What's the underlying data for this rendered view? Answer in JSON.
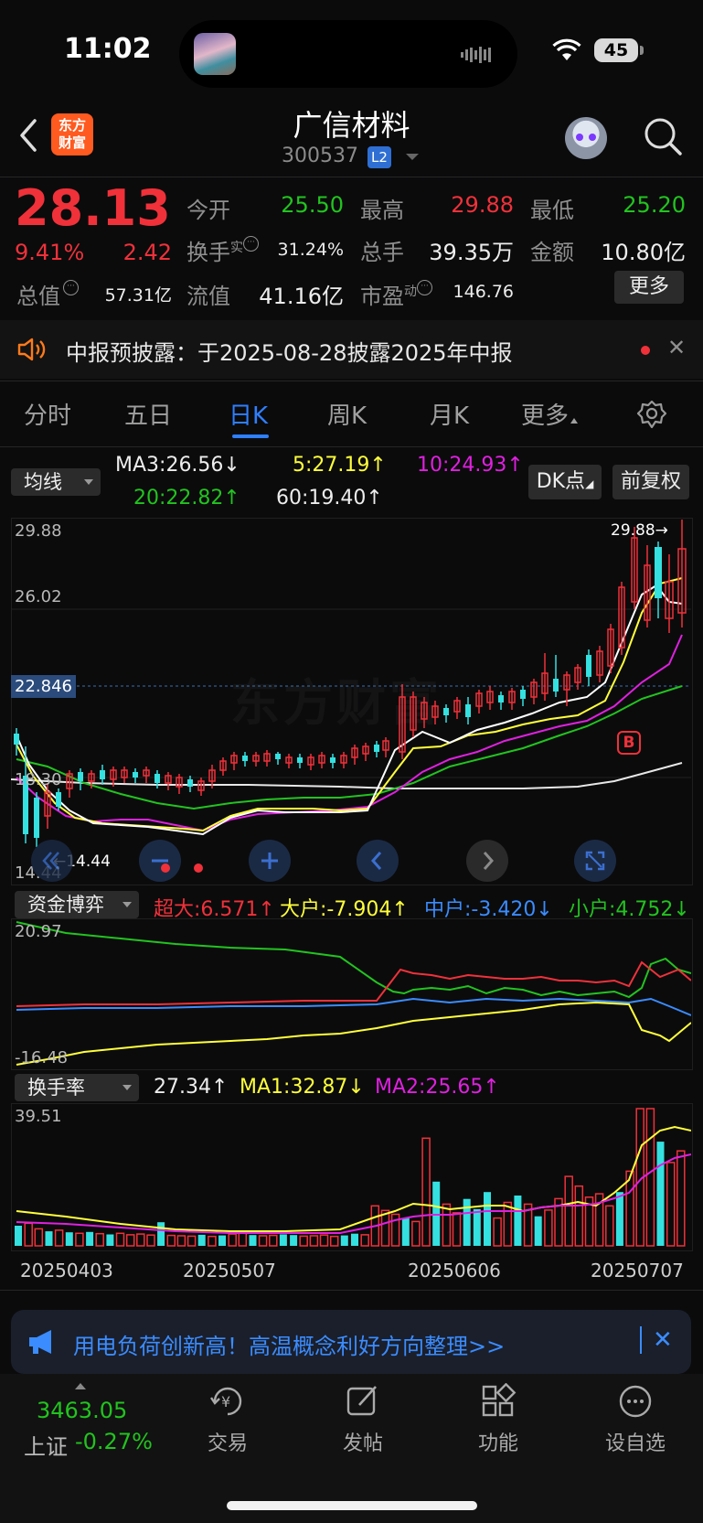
{
  "status": {
    "time": "11:02",
    "battery": "45"
  },
  "header": {
    "brand": "东方\n财富",
    "title": "广信材料",
    "code": "300537",
    "badge": "L2"
  },
  "quote": {
    "price": "28.13",
    "pct": "9.41%",
    "change": "2.42",
    "rows": [
      [
        {
          "label": "今开",
          "value": "25.50",
          "color": "green"
        },
        {
          "label": "最高",
          "value": "29.88",
          "color": "red"
        },
        {
          "label": "最低",
          "value": "25.20",
          "color": "green"
        }
      ],
      [
        {
          "label": "换手",
          "sup": "实",
          "value": "31.24%",
          "color": "white"
        },
        {
          "label": "总手",
          "value": "39.35万",
          "color": "white"
        },
        {
          "label": "金额",
          "value": "10.80亿",
          "color": "white"
        }
      ],
      [
        {
          "label": "总值",
          "value": "57.31亿",
          "color": "white"
        },
        {
          "label": "流值",
          "value": "41.16亿",
          "color": "white"
        },
        {
          "label": "市盈",
          "sup": "动",
          "value": "146.76",
          "color": "white"
        }
      ]
    ],
    "more_label": "更多"
  },
  "notice": {
    "text": "中报预披露：于2025-08-28披露2025年中报"
  },
  "tabs": [
    {
      "label": "分时"
    },
    {
      "label": "五日"
    },
    {
      "label": "日K",
      "active": true
    },
    {
      "label": "周K"
    },
    {
      "label": "月K"
    },
    {
      "label": "更多"
    }
  ],
  "ma_panel": {
    "select": "均线",
    "ma3": "MA3:26.56↓",
    "ma5": "5:27.19↑",
    "ma10": "10:24.93↑",
    "ma20": "20:22.82↑",
    "ma60": "60:19.40↑",
    "dk_label": "DK点",
    "adj_label": "前复权"
  },
  "price_chart": {
    "y_top": "29.88",
    "y_mid": "26.02",
    "y_cur": "22.846",
    "y_mid2": "18.30",
    "y_bot": "14.44",
    "high_mark": "29.88→",
    "low_mark": "←14.44",
    "buy_mark": "B",
    "watermark": "东方财富"
  },
  "fund_panel": {
    "select": "资金博弈",
    "super": "超大:6.571↑",
    "big": "大户:-7.904↑",
    "mid": "中户:-3.420↓",
    "small": "小户:4.752↓",
    "y_top": "20.97",
    "y_bot": "-16.48"
  },
  "turnover_panel": {
    "select": "换手率",
    "value": "27.34↑",
    "ma1": "MA1:32.87↓",
    "ma2": "MA2:25.65↑",
    "y_top": "39.51"
  },
  "dates": [
    "20250403",
    "20250507",
    "20250606",
    "20250707"
  ],
  "banner": {
    "text": "用电负荷创新高！高温概念利好方向整理>>"
  },
  "bottom_nav": {
    "index_value": "3463.05",
    "index_name": "上证",
    "index_pct": "-0.27%",
    "items": [
      {
        "label": "交易"
      },
      {
        "label": "发帖"
      },
      {
        "label": "功能"
      },
      {
        "label": "设自选"
      }
    ]
  },
  "colors": {
    "up": "#f0313a",
    "down": "#22c31f",
    "accent": "#2f7fff",
    "ma5": "#ffff3a",
    "ma10": "#e020e0",
    "ma60": "#ffffff",
    "bar_down": "#34e0e0"
  },
  "chart_data": {
    "type": "candlestick",
    "turnover_bars": [
      {
        "v": 5.8,
        "c": "d"
      },
      {
        "v": 6.5,
        "c": "u"
      },
      {
        "v": 4.9,
        "c": "u"
      },
      {
        "v": 4.2,
        "c": "d"
      },
      {
        "v": 4.5,
        "c": "u"
      },
      {
        "v": 3.9,
        "c": "d"
      },
      {
        "v": 3.6,
        "c": "u"
      },
      {
        "v": 4.0,
        "c": "d"
      },
      {
        "v": 3.5,
        "c": "u"
      },
      {
        "v": 3.3,
        "c": "d"
      },
      {
        "v": 3.6,
        "c": "u"
      },
      {
        "v": 3.2,
        "c": "u"
      },
      {
        "v": 3.4,
        "c": "u"
      },
      {
        "v": 3.1,
        "c": "u"
      },
      {
        "v": 6.8,
        "c": "d"
      },
      {
        "v": 3.0,
        "c": "u"
      },
      {
        "v": 2.9,
        "c": "u"
      },
      {
        "v": 2.8,
        "c": "u"
      },
      {
        "v": 3.2,
        "c": "d"
      },
      {
        "v": 2.7,
        "c": "u"
      },
      {
        "v": 3.0,
        "c": "d"
      },
      {
        "v": 3.4,
        "c": "u"
      },
      {
        "v": 4.2,
        "c": "u"
      },
      {
        "v": 3.1,
        "c": "d"
      },
      {
        "v": 2.9,
        "c": "u"
      },
      {
        "v": 3.0,
        "c": "u"
      },
      {
        "v": 3.3,
        "c": "d"
      },
      {
        "v": 3.1,
        "c": "d"
      },
      {
        "v": 2.8,
        "c": "u"
      },
      {
        "v": 2.9,
        "c": "u"
      },
      {
        "v": 3.1,
        "c": "u"
      },
      {
        "v": 2.7,
        "c": "u"
      },
      {
        "v": 3.0,
        "c": "d"
      },
      {
        "v": 3.5,
        "c": "d"
      },
      {
        "v": 3.2,
        "c": "u"
      },
      {
        "v": 11.5,
        "c": "u"
      },
      {
        "v": 10.2,
        "c": "u"
      },
      {
        "v": 9.1,
        "c": "u"
      },
      {
        "v": 8.0,
        "c": "d"
      },
      {
        "v": 7.0,
        "c": "u"
      },
      {
        "v": 31.0,
        "c": "u"
      },
      {
        "v": 18.5,
        "c": "d"
      },
      {
        "v": 12.0,
        "c": "u"
      },
      {
        "v": 9.5,
        "c": "u"
      },
      {
        "v": 13.5,
        "c": "d"
      },
      {
        "v": 10.6,
        "c": "d"
      },
      {
        "v": 15.5,
        "c": "d"
      },
      {
        "v": 8.0,
        "c": "u"
      },
      {
        "v": 12.5,
        "c": "u"
      },
      {
        "v": 14.5,
        "c": "d"
      },
      {
        "v": 12.0,
        "c": "u"
      },
      {
        "v": 8.5,
        "c": "d"
      },
      {
        "v": 10.3,
        "c": "u"
      },
      {
        "v": 13.6,
        "c": "u"
      },
      {
        "v": 20.0,
        "c": "u"
      },
      {
        "v": 17.2,
        "c": "u"
      },
      {
        "v": 14.0,
        "c": "u"
      },
      {
        "v": 15.0,
        "c": "u"
      },
      {
        "v": 11.5,
        "c": "u"
      },
      {
        "v": 15.5,
        "c": "d"
      },
      {
        "v": 21.5,
        "c": "u"
      },
      {
        "v": 39.5,
        "c": "u"
      },
      {
        "v": 39.5,
        "c": "u"
      },
      {
        "v": 30.0,
        "c": "d"
      },
      {
        "v": 24.0,
        "c": "u"
      },
      {
        "v": 27.34,
        "c": "u"
      }
    ]
  }
}
